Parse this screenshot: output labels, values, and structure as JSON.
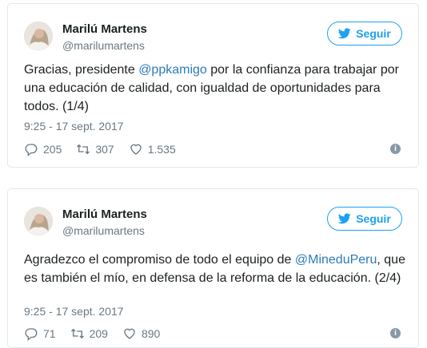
{
  "tweets": [
    {
      "name": "Marilú Martens",
      "handle": "@marilumartens",
      "follow_label": "Seguir",
      "text_before": "Gracias, presidente ",
      "mention": "@ppkamigo",
      "text_after": " por la confianza para trabajar por una educación de calidad, con igualdad de oportunidades para todos. (1/4)",
      "time": "9:25 - 17 sept. 2017",
      "replies": "205",
      "retweets": "307",
      "likes": "1.535",
      "info_icon": "i"
    },
    {
      "name": "Marilú Martens",
      "handle": "@marilumartens",
      "follow_label": "Seguir",
      "text_before": "Agradezco el compromiso de todo el equipo de ",
      "mention": "@MineduPeru",
      "text_after": ", que es también el mío, en defensa de la reforma de la educación. (2/4)",
      "time": "9:25 - 17 sept. 2017",
      "replies": "71",
      "retweets": "209",
      "likes": "890",
      "info_icon": "i"
    }
  ],
  "colors": {
    "accent": "#1da1f2",
    "mention": "#2b7bb9",
    "muted": "#697882",
    "border": "#e1e8ed"
  },
  "icons": [
    "avatar",
    "bird-icon",
    "reply-icon",
    "retweet-icon",
    "heart-icon",
    "info-icon"
  ]
}
